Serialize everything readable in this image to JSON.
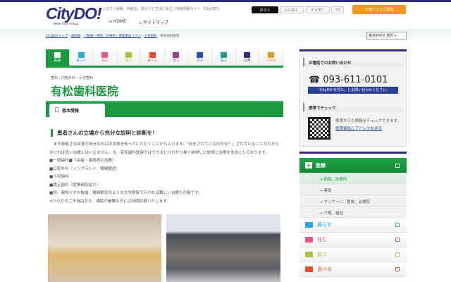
{
  "header": {
    "logo": "CityDO!",
    "logo_sub": "News from Suhaa",
    "tagline": "ふるさと納税、特産品、旅行など生活に役立つ地域情報サイト「CityDO!」",
    "nav": [
      {
        "icon": "home-icon",
        "label": "HOME"
      },
      {
        "icon": "sitemap-icon",
        "label": "サイトマップ"
      }
    ],
    "social": {
      "post": "ポスト",
      "like": "いいね！",
      "iine": "イイネ！",
      "gplus": "+1"
    },
    "favorite_button": "お気に入りに追加"
  },
  "breadcrumb": [
    "CityDO!トップ",
    "福岡県",
    "「医療・病院、診療所」関連施設リスト",
    "小児歯科",
    "有松歯科医院"
  ],
  "pref_select": "都道府県を選択",
  "categories": [
    {
      "label": "医療",
      "color": "#1b9a3f"
    },
    {
      "label": "暮らす",
      "color": "#29a9df"
    },
    {
      "label": "住む",
      "color": "#e8508c"
    },
    {
      "label": "遊ぶ",
      "color": "#a8c43a"
    },
    {
      "label": "食べる",
      "color": "#e84a2c"
    },
    {
      "label": "装う",
      "color": "#9b3d8f"
    },
    {
      "label": "学ぶ",
      "color": "#2850b4"
    },
    {
      "label": "選ぶ",
      "color": "#1e9a8e"
    },
    {
      "label": "公共",
      "color": "#2c3085"
    },
    {
      "label": "その他",
      "color": "#e89a1e"
    }
  ],
  "clinic": {
    "category": "歯科・口腔外科・小児歯科",
    "name": "有松歯科医院",
    "tab": "基本情報",
    "heading": "患者さんの立場から充分な説明と診断を！",
    "body": [
      "　まず患者さま自身が自分のお口の状態を知っていただくことから入ります。「何をされているのかな？」されていることがわからなければ良い治療とはいえません。当、有松歯科医院ではできるだけ分かり易く納得した説明と治療を信念としております。",
      "■一般歯科■（虫歯・歯周病の治療）",
      "■口腔外科（インプラント、顎関節症）",
      "■小児歯科",
      "■矯正歯科（提携病院紹介）",
      "■他、親知らずの抜歯、顎関節症のような大学病院で行われる難しい治療も可能です。",
      "※からだのご不自由な方、通院が困難な方には訪問診療いたします。"
    ]
  },
  "sidebar": {
    "phone_heading": "お電話でのお問い合わせ",
    "phone": "☎ 093-611-0101",
    "phone_note": "「CityDO!を見た」とお問い合わせください。",
    "mobile_heading": "携帯でチェック",
    "mobile_text": "携帯からも情報をチェックできます。",
    "mobile_link": "携帯電話にアドレスを送る",
    "menu_head": "医療",
    "menu_subs": [
      "→ 病院、診療所",
      "→ 薬局",
      "→ マッサージ、整体、治療院",
      "→ 介護、福祉"
    ],
    "menu_rows": [
      {
        "label": "暮らす",
        "color": "#29a9df"
      },
      {
        "label": "住む",
        "color": "#e8508c"
      },
      {
        "label": "遊ぶ",
        "color": "#a8c43a"
      },
      {
        "label": "食べる",
        "color": "#e84a2c"
      }
    ]
  }
}
